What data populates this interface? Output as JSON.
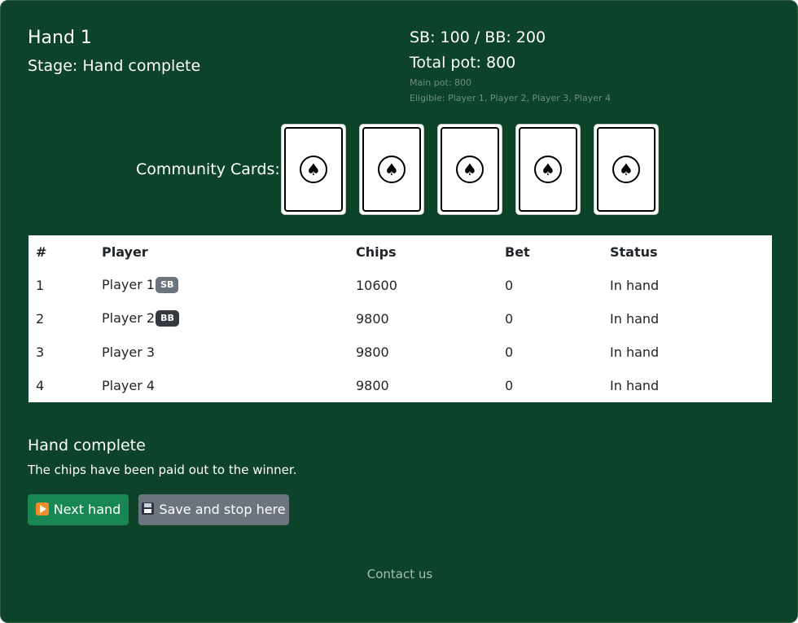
{
  "hand": {
    "title": "Hand 1",
    "stage": "Stage: Hand complete"
  },
  "pot": {
    "blinds": "SB: 100 / BB: 200",
    "total": "Total pot: 800",
    "main_pot": "Main pot: 800",
    "eligible": "Eligible: Player 1, Player 2, Player 3, Player 4"
  },
  "community": {
    "label": "Community Cards:",
    "cards": [
      {
        "face": "back",
        "symbol": "♠",
        "icon": "spade-icon"
      },
      {
        "face": "back",
        "symbol": "♠",
        "icon": "spade-icon"
      },
      {
        "face": "back",
        "symbol": "♠",
        "icon": "spade-icon"
      },
      {
        "face": "back",
        "symbol": "♠",
        "icon": "spade-icon"
      },
      {
        "face": "back",
        "symbol": "♠",
        "icon": "spade-icon"
      }
    ]
  },
  "table": {
    "headers": [
      "#",
      "Player",
      "Chips",
      "Bet",
      "Status"
    ],
    "rows": [
      {
        "num": "1",
        "player": "Player 1",
        "badge": "SB",
        "chips": "10600",
        "bet": "0",
        "status": "In hand"
      },
      {
        "num": "2",
        "player": "Player 2",
        "badge": "BB",
        "chips": "9800",
        "bet": "0",
        "status": "In hand"
      },
      {
        "num": "3",
        "player": "Player 3",
        "badge": "",
        "chips": "9800",
        "bet": "0",
        "status": "In hand"
      },
      {
        "num": "4",
        "player": "Player 4",
        "badge": "",
        "chips": "9800",
        "bet": "0",
        "status": "In hand"
      }
    ]
  },
  "result": {
    "title": "Hand complete",
    "message": "The chips have been paid out to the winner."
  },
  "buttons": {
    "next_hand": "Next hand",
    "next_hand_icon": "play-icon",
    "save_stop": "Save and stop here",
    "save_stop_icon": "floppy-disk-icon"
  },
  "footer": {
    "contact": "Contact us"
  },
  "colors": {
    "background": "#0d432a",
    "next_button": "#198754",
    "save_button": "#6c757d",
    "sb_badge": "#6c757d",
    "bb_badge": "#343a40"
  }
}
